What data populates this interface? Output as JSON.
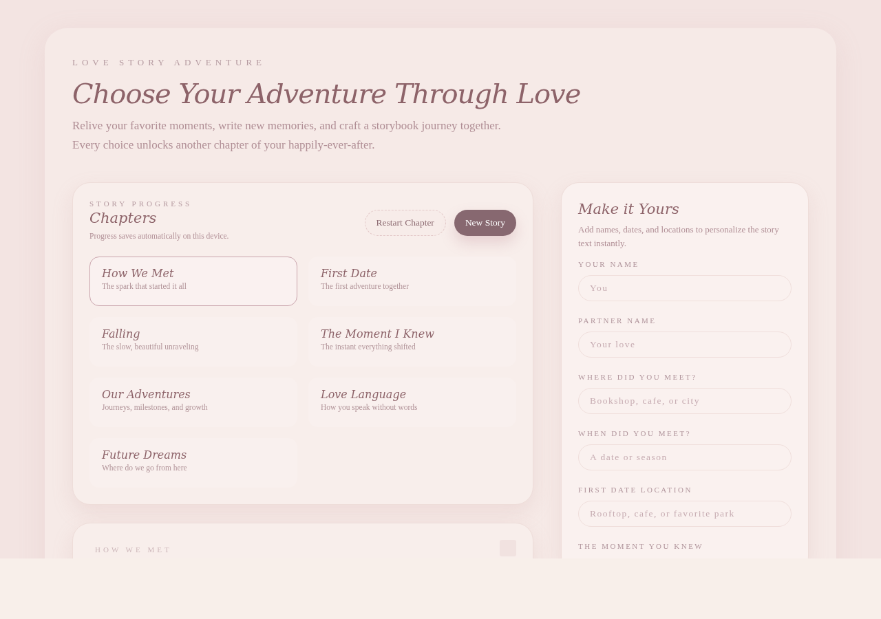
{
  "header": {
    "eyebrow": "LOVE STORY ADVENTURE",
    "title": "Choose Your Adventure Through Love",
    "subtitle": "Relive your favorite moments, write new memories, and craft a storybook journey together. Every choice unlocks another chapter of your happily-ever-after."
  },
  "progress": {
    "eyebrow": "STORY PROGRESS",
    "title": "Chapters",
    "note": "Progress saves automatically on this device.",
    "buttons": [
      {
        "label": "Restart Chapter",
        "kind": "outline"
      },
      {
        "label": "New Story",
        "kind": "filled"
      }
    ],
    "chapters": [
      {
        "title": "How We Met",
        "subtitle": "The spark that started it all",
        "selected": true
      },
      {
        "title": "First Date",
        "subtitle": "The first adventure together",
        "selected": false
      },
      {
        "title": "Falling",
        "subtitle": "The slow, beautiful unraveling",
        "selected": false
      },
      {
        "title": "The Moment I Knew",
        "subtitle": "The instant everything shifted",
        "selected": false
      },
      {
        "title": "Our Adventures",
        "subtitle": "Journeys, milestones, and growth",
        "selected": false
      },
      {
        "title": "Love Language",
        "subtitle": "How you speak without words",
        "selected": false
      },
      {
        "title": "Future Dreams",
        "subtitle": "Where do we go from here",
        "selected": false
      }
    ]
  },
  "story": {
    "eyebrow": "HOW WE MET"
  },
  "personalize": {
    "title": "Make it Yours",
    "description": "Add names, dates, and locations to personalize the story text instantly.",
    "fields": [
      {
        "label": "YOUR NAME",
        "placeholder": "You"
      },
      {
        "label": "PARTNER NAME",
        "placeholder": "Your love"
      },
      {
        "label": "WHERE DID YOU MEET?",
        "placeholder": "Bookshop, cafe, or city"
      },
      {
        "label": "WHEN DID YOU MEET?",
        "placeholder": "A date or season"
      },
      {
        "label": "FIRST DATE LOCATION",
        "placeholder": "Rooftop, cafe, or favorite park"
      },
      {
        "label": "THE MOMENT YOU KNEW"
      }
    ]
  }
}
